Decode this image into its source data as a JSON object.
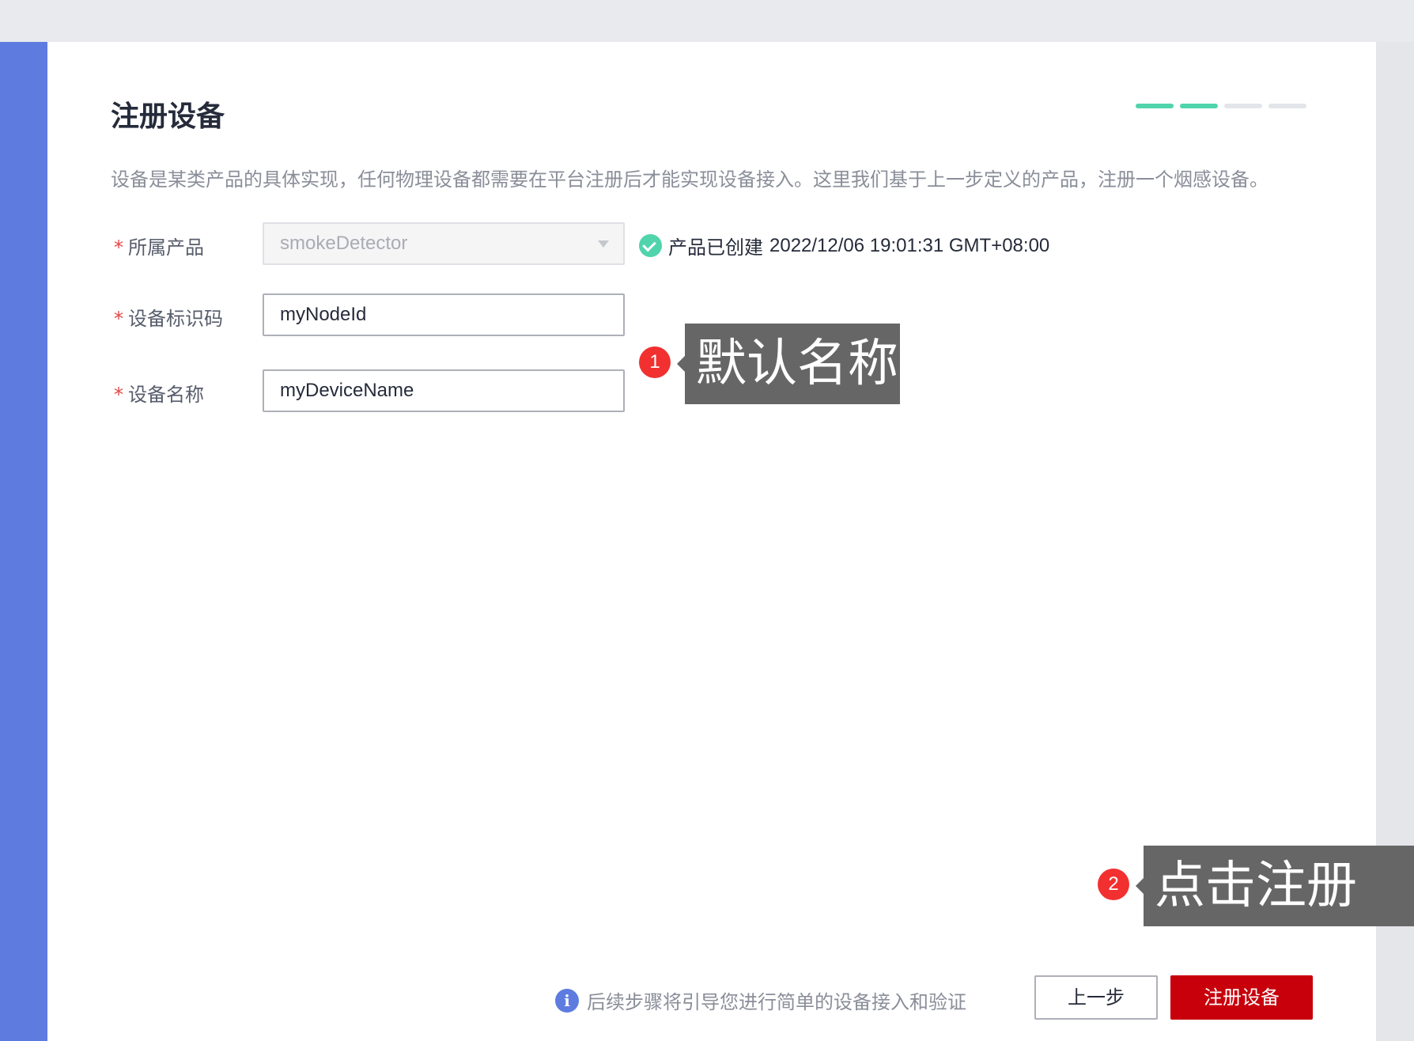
{
  "page": {
    "title": "注册设备",
    "description": "设备是某类产品的具体实现，任何物理设备都需要在平台注册后才能实现设备接入。这里我们基于上一步定义的产品，注册一个烟感设备。",
    "progress_steps_done": 2,
    "progress_steps_total": 4
  },
  "form": {
    "required_mark": "*",
    "product": {
      "label": "所属产品",
      "value": "smokeDetector"
    },
    "product_status": {
      "label": "产品已创建",
      "timestamp": "2022/12/06 19:01:31 GMT+08:00"
    },
    "node_id": {
      "label": "设备标识码",
      "value": "myNodeId"
    },
    "device_name": {
      "label": "设备名称",
      "value": "myDeviceName"
    }
  },
  "annotations": [
    {
      "number": "1",
      "text": "默认名称"
    },
    {
      "number": "2",
      "text": "点击注册"
    }
  ],
  "footer": {
    "hint": "后续步骤将引导您进行简单的设备接入和验证",
    "prev_label": "上一步",
    "register_label": "注册设备"
  },
  "colors": {
    "sidebar": "#5e7ce0",
    "progress_done": "#50d4ab",
    "primary_button": "#c7000b",
    "badge": "#f23030",
    "callout": "#666666"
  }
}
